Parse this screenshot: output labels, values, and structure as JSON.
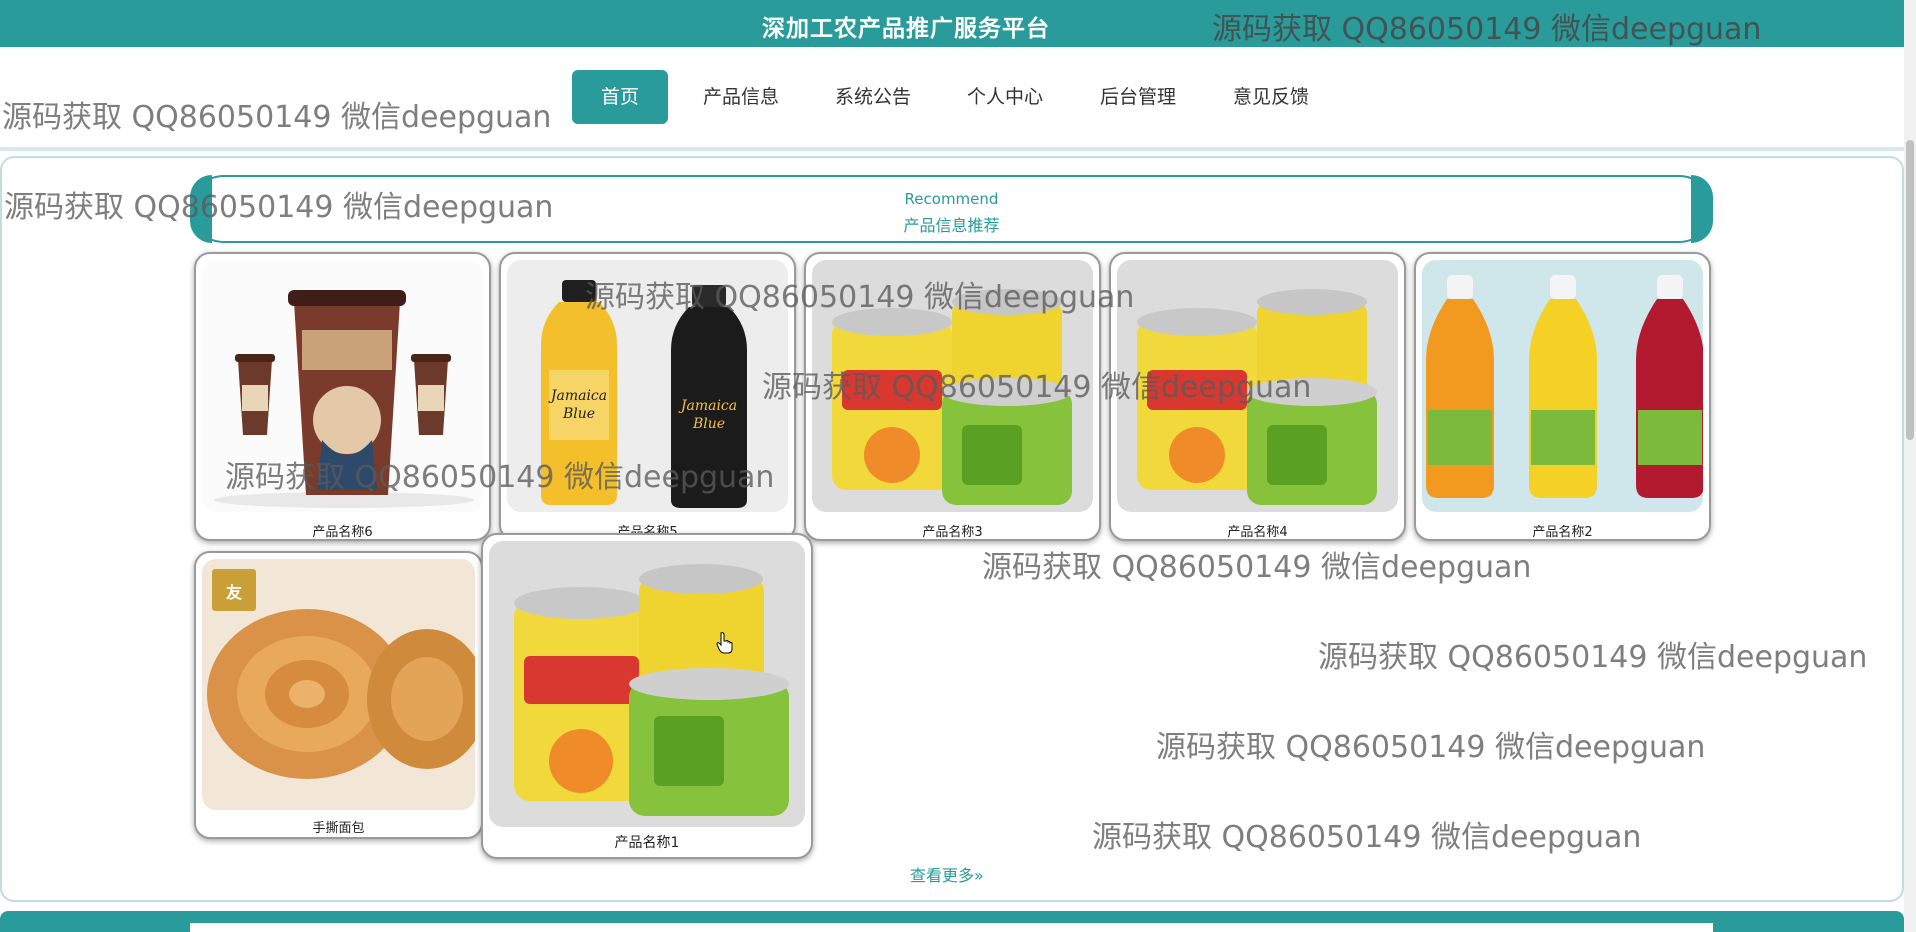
{
  "site": {
    "title": "深加工农产品推广服务平台"
  },
  "watermark": {
    "text": "源码获取 QQ86050149 微信deepguan"
  },
  "nav": {
    "items": [
      {
        "label": "首页",
        "active": true
      },
      {
        "label": "产品信息"
      },
      {
        "label": "系统公告"
      },
      {
        "label": "个人中心"
      },
      {
        "label": "后台管理"
      },
      {
        "label": "意见反馈"
      }
    ]
  },
  "recommend": {
    "title_en": "Recommend",
    "title_cn": "产品信息推荐"
  },
  "products": [
    {
      "name": "产品名称6",
      "image": "coffee-cups-image"
    },
    {
      "name": "产品名称5",
      "image": "jamaica-bottles-image"
    },
    {
      "name": "产品名称3",
      "image": "juice-cans-image"
    },
    {
      "name": "产品名称4",
      "image": "juice-cans-image"
    },
    {
      "name": "产品名称2",
      "image": "juice-bottles-image"
    },
    {
      "name": "手撕面包",
      "image": "bread-image"
    },
    {
      "name": "产品名称1",
      "image": "juice-cans-image"
    }
  ],
  "more": {
    "label": "查看更多»"
  },
  "colors": {
    "brand": "#2a9b9b"
  }
}
